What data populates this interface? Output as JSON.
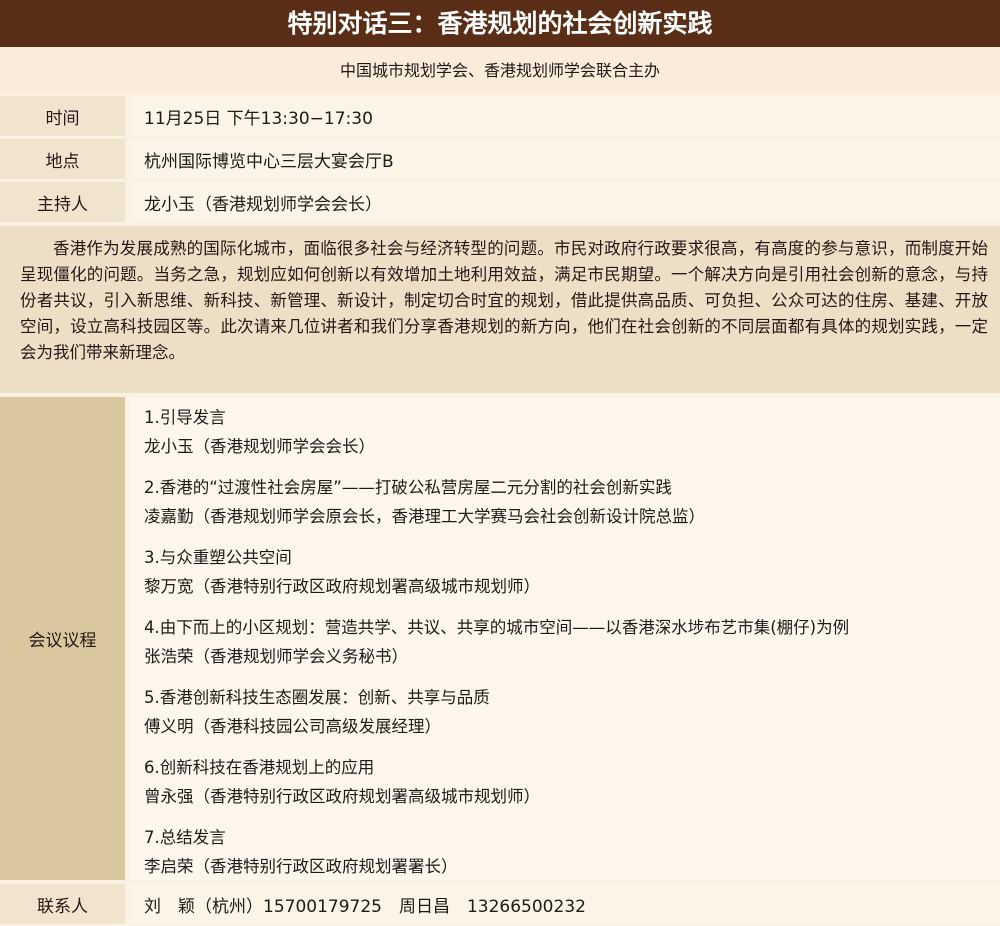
{
  "header": {
    "title": "特别对话三：香港规划的社会创新实践"
  },
  "organizer": "中国城市规划学会、香港规划师学会联合主办",
  "info": {
    "time_label": "时间",
    "time_value": "11月25日 下午13:30−17:30",
    "place_label": "地点",
    "place_value": "杭州国际博览中心三层大宴会厅B",
    "host_label": "主持人",
    "host_value": "龙小玉（香港规划师学会会长）"
  },
  "intro": "香港作为发展成熟的国际化城市，面临很多社会与经济转型的问题。市民对政府行政要求很高，有高度的参与意识，而制度开始呈现僵化的问题。当务之急，规划应如何创新以有效增加土地利用效益，满足市民期望。一个解决方向是引用社会创新的意念，与持份者共议，引入新思维、新科技、新管理、新设计，制定切合时宜的规划，借此提供高品质、可负担、公众可达的住房、基建、开放空间，设立高科技园区等。此次请来几位讲者和我们分享香港规划的新方向，他们在社会创新的不同层面都有具体的规划实践，一定会为我们带来新理念。",
  "agenda": {
    "label": "会议议程",
    "items": [
      {
        "title": "1.引导发言",
        "speaker": "龙小玉（香港规划师学会会长）"
      },
      {
        "title": "2.香港的“过渡性社会房屋”——打破公私营房屋二元分割的社会创新实践",
        "speaker": "凌嘉勤（香港规划师学会原会长，香港理工大学赛马会社会创新设计院总监）"
      },
      {
        "title": "3.与众重塑公共空间",
        "speaker": "黎万宽（香港特别行政区政府规划署高级城市规划师）"
      },
      {
        "title": "4.由下而上的小区规划：营造共学、共议、共享的城市空间——以香港深水埗布艺市集(棚仔)为例",
        "speaker": "张浩荣（香港规划师学会义务秘书）"
      },
      {
        "title": "5.香港创新科技生态圈发展：创新、共享与品质",
        "speaker": "傅义明（香港科技园公司高级发展经理）"
      },
      {
        "title": "6.创新科技在香港规划上的应用",
        "speaker": "曾永强（香港特别行政区政府规划署高级城市规划师）"
      },
      {
        "title": "7.总结发言",
        "speaker": "李启荣（香港特别行政区政府规划署署长）"
      }
    ]
  },
  "contact": {
    "label": "联系人",
    "value": "刘　颖（杭州）15700179725　周日昌　13266500232"
  }
}
